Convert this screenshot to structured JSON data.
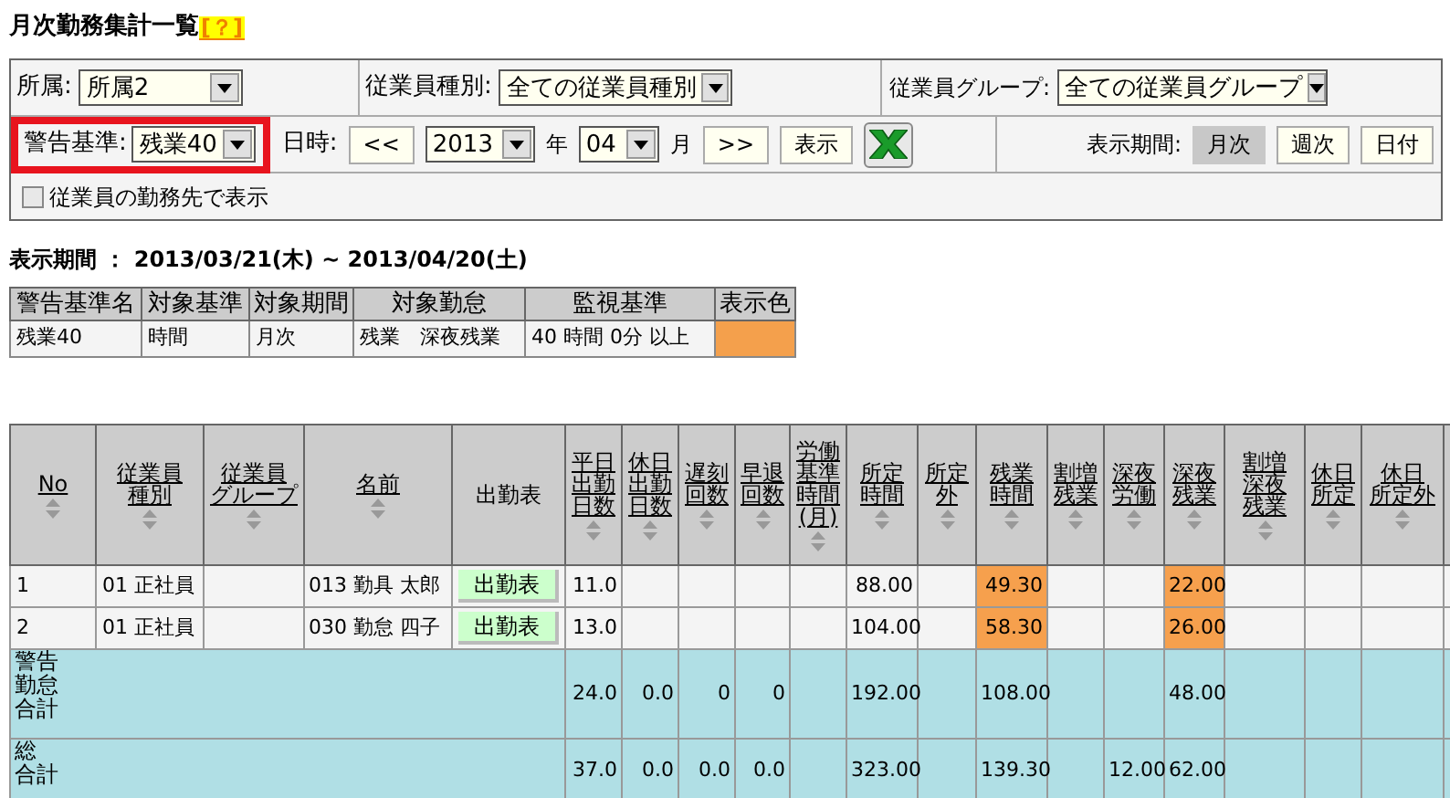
{
  "page_title": "月次勤務集計一覧",
  "help_link": "[？]",
  "filters": {
    "department": {
      "label": "所属:",
      "value": "所属2"
    },
    "employee_type": {
      "label": "従業員種別:",
      "value": "全ての従業員種別"
    },
    "employee_group": {
      "label": "従業員グループ:",
      "value": "全ての従業員グループ"
    },
    "warning_standard": {
      "label": "警告基準:",
      "value": "残業40",
      "highlighted": true
    },
    "date_label": "日時:",
    "prev_button": "<<",
    "year": "2013",
    "year_unit": "年",
    "month": "04",
    "month_unit": "月",
    "next_button": ">>",
    "show_button": "表示",
    "period_label": "表示期間:",
    "period_tabs": [
      {
        "label": "月次",
        "selected": true
      },
      {
        "label": "週次",
        "selected": false
      },
      {
        "label": "日付",
        "selected": false
      }
    ],
    "workplace_checkbox": {
      "label": "従業員の勤務先で表示",
      "checked": false
    }
  },
  "period_line": "表示期間 ： 2013/03/21(木) ~ 2013/04/20(土)",
  "warning_table": {
    "columns": [
      "警告基準名",
      "対象基準",
      "対象期間",
      "対象勤怠",
      "監視基準",
      "表示色"
    ],
    "rows": [
      {
        "cells": [
          "残業40",
          "時間",
          "月次",
          "残業　深夜残業",
          "40 時間 0分 以上"
        ],
        "color": "#f4a04c"
      }
    ]
  },
  "main_table": {
    "columns": [
      {
        "lines": [
          "No"
        ],
        "sortable": true
      },
      {
        "lines": [
          "従業員",
          "種別"
        ],
        "sortable": true
      },
      {
        "lines": [
          "従業員",
          "グループ"
        ],
        "sortable": true
      },
      {
        "lines": [
          "名前"
        ],
        "sortable": true
      },
      {
        "lines": [
          "出勤表"
        ],
        "sortable": false
      },
      {
        "lines": [
          "平日",
          "出勤",
          "日数"
        ],
        "sortable": true
      },
      {
        "lines": [
          "休日",
          "出勤",
          "日数"
        ],
        "sortable": true
      },
      {
        "lines": [
          "遅刻",
          "回数"
        ],
        "sortable": true
      },
      {
        "lines": [
          "早退",
          "回数"
        ],
        "sortable": true
      },
      {
        "lines": [
          "労働",
          "基準",
          "時間",
          "(月)"
        ],
        "sortable": true
      },
      {
        "lines": [
          "所定",
          "時間"
        ],
        "sortable": true
      },
      {
        "lines": [
          "所定",
          "外"
        ],
        "sortable": true
      },
      {
        "lines": [
          "残業",
          "時間"
        ],
        "sortable": true
      },
      {
        "lines": [
          "割増",
          "残業"
        ],
        "sortable": true
      },
      {
        "lines": [
          "深夜",
          "労働"
        ],
        "sortable": true
      },
      {
        "lines": [
          "深夜",
          "残業"
        ],
        "sortable": true
      },
      {
        "lines": [
          "割増",
          "深夜",
          "残業"
        ],
        "sortable": true
      },
      {
        "lines": [
          "休日",
          "所定"
        ],
        "sortable": true
      },
      {
        "lines": [
          "休日",
          "所定外"
        ],
        "sortable": true
      }
    ],
    "rows": [
      {
        "no": "1",
        "type": "01 正社員",
        "name": "013 勤具 太郎",
        "button": "出勤表",
        "values": [
          {
            "text": "11.0",
            "alert": false
          },
          {
            "alert": false
          },
          {
            "alert": false
          },
          {
            "alert": false
          },
          {
            "alert": false
          },
          {
            "text": "88.00",
            "alert": false
          },
          {
            "alert": false
          },
          {
            "text": "49.30",
            "alert": true
          },
          {
            "alert": false
          },
          {
            "alert": false
          },
          {
            "text": "22.00",
            "alert": true
          },
          {
            "alert": false
          },
          {
            "alert": false
          },
          {
            "alert": false
          }
        ]
      },
      {
        "no": "2",
        "type": "01 正社員",
        "name": "030 勤怠 四子",
        "button": "出勤表",
        "values": [
          {
            "text": "13.0",
            "alert": false
          },
          {
            "alert": false
          },
          {
            "alert": false
          },
          {
            "alert": false
          },
          {
            "alert": false
          },
          {
            "text": "104.00",
            "alert": false
          },
          {
            "alert": false
          },
          {
            "text": "58.30",
            "alert": true
          },
          {
            "alert": false
          },
          {
            "alert": false
          },
          {
            "text": "26.00",
            "alert": true
          },
          {
            "alert": false
          },
          {
            "alert": false
          },
          {
            "alert": false
          }
        ]
      }
    ],
    "summary_rows": [
      {
        "lines": [
          "警告",
          "勤怠",
          "合計"
        ],
        "values": [
          {
            "text": "24.0",
            "alert": false
          },
          {
            "text": "0.0",
            "alert": false
          },
          {
            "text": "0",
            "alert": false
          },
          {
            "text": "0",
            "alert": false
          },
          {
            "alert": false
          },
          {
            "text": "192.00",
            "alert": false
          },
          {
            "alert": false
          },
          {
            "text": "108.00",
            "alert": false
          },
          {
            "alert": false
          },
          {
            "alert": false
          },
          {
            "text": "48.00",
            "alert": false
          },
          {
            "alert": false
          },
          {
            "alert": false
          },
          {
            "alert": false
          }
        ]
      },
      {
        "lines": [
          "総",
          "合計"
        ],
        "values": [
          {
            "text": "37.0",
            "alert": false
          },
          {
            "text": "0.0",
            "alert": false
          },
          {
            "text": "0.0",
            "alert": false
          },
          {
            "text": "0.0",
            "alert": false
          },
          {
            "alert": false
          },
          {
            "text": "323.00",
            "alert": false
          },
          {
            "alert": false
          },
          {
            "text": "139.30",
            "alert": false
          },
          {
            "alert": false
          },
          {
            "text": "12.00",
            "alert": false
          },
          {
            "text": "62.00",
            "alert": false
          },
          {
            "alert": false
          },
          {
            "alert": false
          },
          {
            "alert": false
          }
        ]
      }
    ]
  }
}
